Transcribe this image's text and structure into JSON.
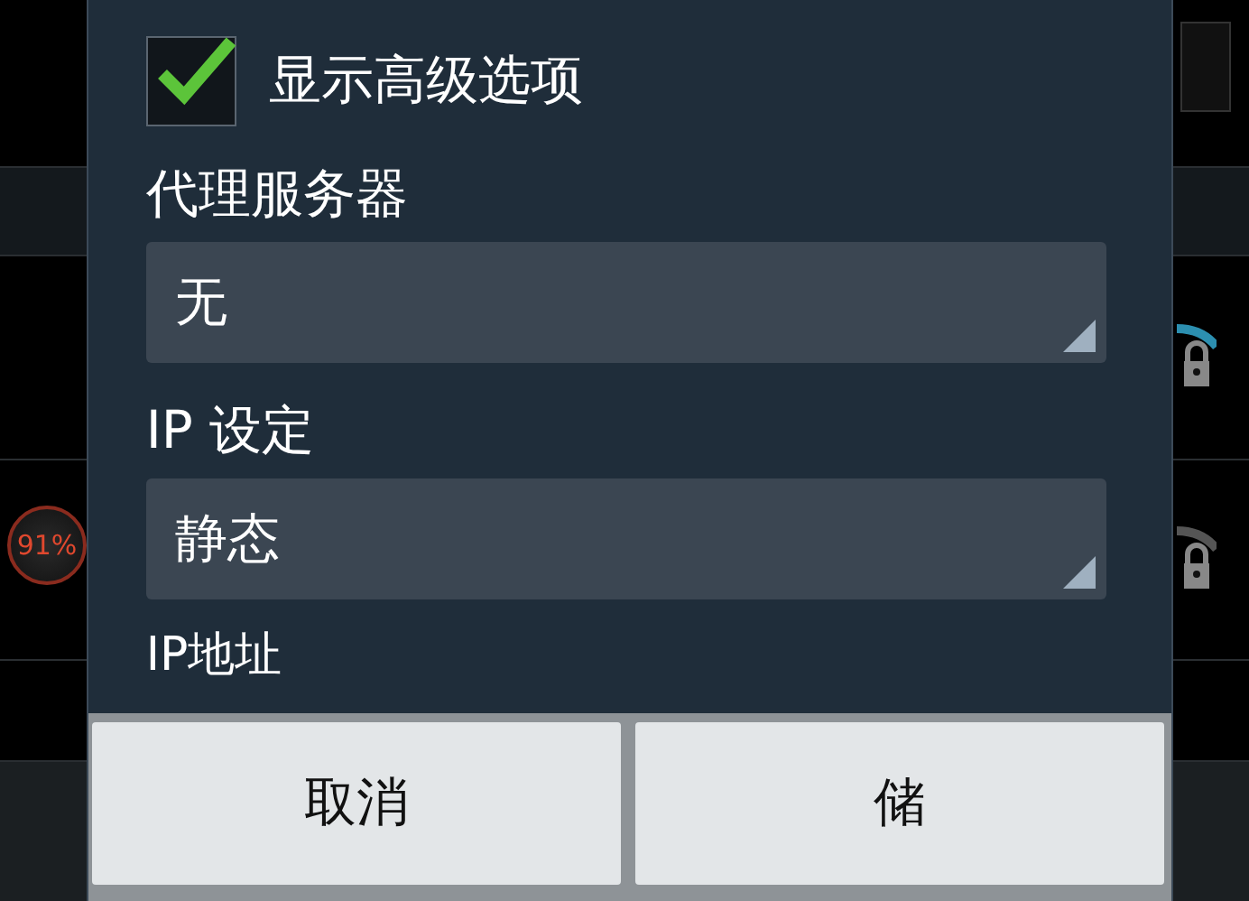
{
  "background": {
    "battery_badge": "91%"
  },
  "dialog": {
    "advanced": {
      "label": "显示高级选项",
      "checked": true
    },
    "fields": [
      {
        "label": "代理服务器",
        "value": "无"
      },
      {
        "label": "IP 设定",
        "value": "静态"
      }
    ],
    "next_label": "IP地址",
    "buttons": [
      "取消",
      "储"
    ]
  }
}
